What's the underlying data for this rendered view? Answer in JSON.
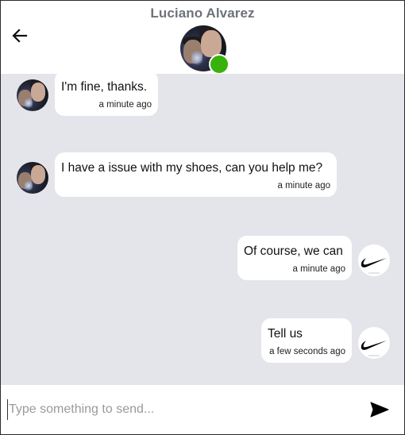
{
  "header": {
    "contact_name": "Luciano Alvarez",
    "status": "online",
    "status_color": "#38b20b"
  },
  "icons": {
    "back": "arrow-left-icon",
    "send": "send-icon",
    "brand": "nike-swoosh-logo"
  },
  "messages": [
    {
      "from": "contact",
      "text": "I'm fine, thanks.",
      "time": "a minute ago"
    },
    {
      "from": "contact",
      "text": "I have a issue with my shoes, can you help me?",
      "time": "a minute ago"
    },
    {
      "from": "me",
      "text": "Of course, we can",
      "time": "a minute ago"
    },
    {
      "from": "me",
      "text": "Tell us",
      "time": "a few seconds ago"
    }
  ],
  "composer": {
    "placeholder": "Type something to send...",
    "value": ""
  },
  "colors": {
    "chat_background": "#e4e5ea",
    "bubble": "#ffffff",
    "header_name": "#6e7279"
  }
}
